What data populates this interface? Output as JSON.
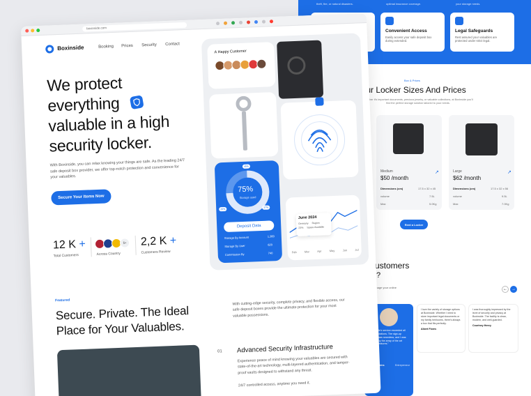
{
  "back_page": {
    "top_snippets": [
      "theft, fire, or natural disasters.",
      "optimal insurance coverage.",
      "your storage needs."
    ],
    "features": [
      {
        "title": "urity",
        "desc": "access control."
      },
      {
        "title": "Convenient Access",
        "desc": "Easily access your safe deposit box during extended."
      },
      {
        "title": "Legal Safeguards",
        "desc": "Rest assured your valuables are protected under strict legal."
      }
    ],
    "sizes_tag": "Box & Prices",
    "sizes_title": "Our Locker Sizes And Prices",
    "sizes_desc": "Whether it's important documents, precious jewelry, or valuable collections, at Boxinside you'll find the perfect storage solution tailored to your needs.",
    "lockers": [
      {
        "size": "Medium",
        "price": "$50 /month",
        "rows": [
          [
            "Dimensions (cm)",
            "17.5 x 32 x 45"
          ],
          [
            "volume",
            "7.5L"
          ],
          [
            "Max",
            "5.0Kg"
          ]
        ]
      },
      {
        "size": "Large",
        "price": "$62 /month",
        "rows": [
          [
            "Dimensions (cm)",
            "17.5 x 32 x 56"
          ],
          [
            "volume",
            "9.5L"
          ],
          [
            "Max",
            "7.0Kg"
          ]
        ]
      }
    ],
    "rent_button": "Rent a Locker",
    "customers_title": "ur customers",
    "customers_sub": "inside",
    "customers_desc": "to easily manage your online",
    "testimonials": [
      {
        "quote": "\"Boxinside's service exceeded all my expectations. The sign-up process was seamless, and I was amazed by the array of the art security features.\"",
        "name": "Ikey Hawkins",
        "role": "Entrepreneur"
      },
      {
        "quote": "I love the variety of storage options at Boxinside. Whether I need to store important legal documents or my family heirlooms, there's always a box that fits perfectly.",
        "name": "Albert Flores",
        "role": "Marketing Coordinator"
      },
      {
        "quote": "I was thoroughly impressed by the level of security and privacy at Boxinside. The facility is clean, modern, and well-guarded.",
        "name": "Courtney Henry",
        "role": "Marketing Coordinator"
      }
    ]
  },
  "browser": {
    "url": "boxinside.com"
  },
  "nav": {
    "logo": "Boxinside",
    "links": [
      "Booking",
      "Prices",
      "Security",
      "Contact"
    ]
  },
  "hero": {
    "line1": "We protect",
    "line2": "everything",
    "line3": "valuable in a high",
    "line4": "security locker.",
    "desc": "With Boxinside, you can relax knowing your things are safe. As the leading 24/7 safe deposit box provider, we offer top-notch protection and convenience for your valuables.",
    "cta": "Secure Your  Items Now"
  },
  "stats": [
    {
      "value": "12 K",
      "plus": "+",
      "label": "Total Customers"
    },
    {
      "value": "",
      "plus": "",
      "label": "Across Country",
      "badge": "5+"
    },
    {
      "value": "2,2 K",
      "plus": "+",
      "label": "Customers Review"
    }
  ],
  "mockup": {
    "happy_title": "A Happy Customer",
    "storage_pct": "75%",
    "storage_label": "Storage used",
    "ring_marks": [
      "45%",
      "20%",
      "37%"
    ],
    "deposit_button": "Deposit Data",
    "deposit_rows": [
      [
        "Storage By Account",
        "1,360"
      ],
      [
        "Storage By User",
        "620"
      ],
      [
        "Commission By",
        "740"
      ]
    ],
    "chart_title": "June 2024",
    "chart_legend": [
      [
        "Germany",
        "Region"
      ],
      [
        "23%",
        "Space Available"
      ]
    ],
    "chart_months": [
      "Feb",
      "Mar",
      "Apr",
      "May",
      "Jun",
      "Jul"
    ]
  },
  "featured": {
    "tag": "Featured",
    "title1": "Secure. Private. The Ideal",
    "title2": "Place for Your Valuables.",
    "desc": "With cutting-edge security, complete privacy, and flexible access, our safe deposit boxes provide the ultimate protection for your most valuable possessions.",
    "item_num": "01",
    "item_title": "Advanced Security Infrastructure",
    "item_desc": "Experience peace of mind knowing your valuables are secured with state-of-the-art technology, multi-layered authentication, and tamper-proof vaults designed to withstand any threat.",
    "item_more": "24/7 controlled access, anytime you need it."
  },
  "colors": {
    "accent": "#1d6ee6",
    "dark": "#111111"
  }
}
